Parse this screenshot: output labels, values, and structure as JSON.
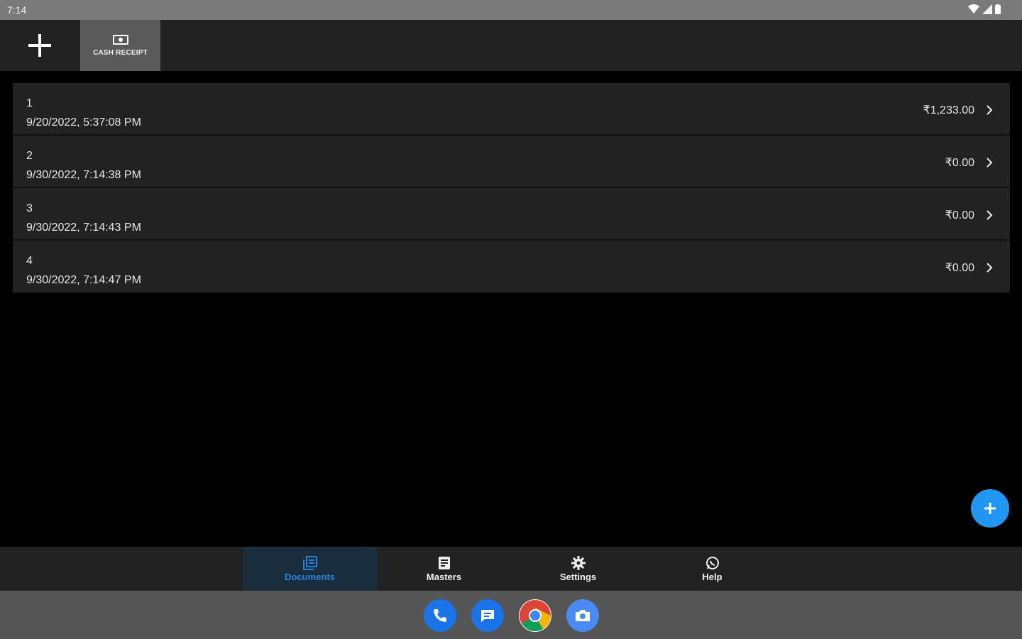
{
  "status_bar": {
    "time": "7:14",
    "icons": [
      "wifi-icon",
      "signal-icon",
      "battery-icon"
    ]
  },
  "toolbar": {
    "add_icon": "plus-icon",
    "tab_cash_receipt": {
      "label": "CASH RECEIPT",
      "icon": "cash-icon"
    }
  },
  "documents": [
    {
      "number": "1",
      "datetime": "9/20/2022, 5:37:08 PM",
      "amount": "₹1,233.00"
    },
    {
      "number": "2",
      "datetime": "9/30/2022, 7:14:38 PM",
      "amount": "₹0.00"
    },
    {
      "number": "3",
      "datetime": "9/30/2022, 7:14:43 PM",
      "amount": "₹0.00"
    },
    {
      "number": "4",
      "datetime": "9/30/2022, 7:14:47 PM",
      "amount": "₹0.00"
    }
  ],
  "fab": {
    "icon": "plus-icon",
    "color": "#2196f3"
  },
  "bottom_nav": [
    {
      "label": "Documents",
      "icon": "documents-icon",
      "active": true
    },
    {
      "label": "Masters",
      "icon": "masters-icon",
      "active": false
    },
    {
      "label": "Settings",
      "icon": "gear-icon",
      "active": false
    },
    {
      "label": "Help",
      "icon": "whatsapp-icon",
      "active": false
    }
  ],
  "dock_apps": [
    "phone-icon",
    "messages-icon",
    "chrome-icon",
    "camera-icon"
  ],
  "colors": {
    "accent": "#2196f3",
    "active_nav_text": "#2a82d6",
    "surface": "#222222",
    "background": "#000000"
  }
}
